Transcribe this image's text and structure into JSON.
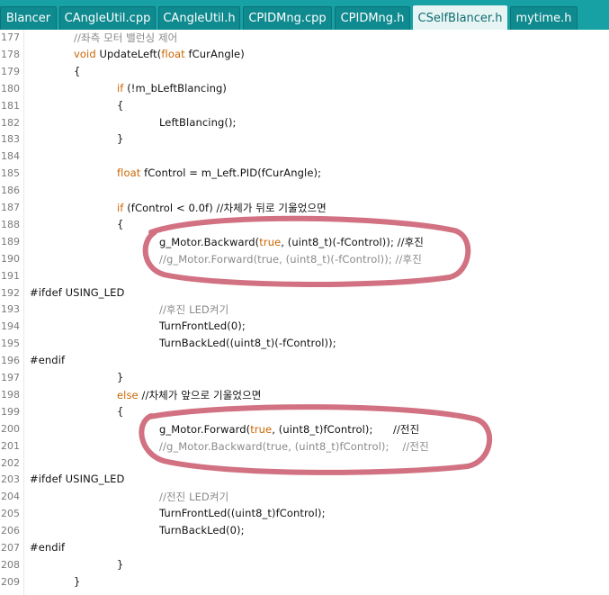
{
  "tabs": [
    {
      "label": "Blancer",
      "width": 63,
      "active": false
    },
    {
      "label": "CAngleUtil.cpp",
      "width": 107,
      "active": false
    },
    {
      "label": "CAngleUtil.h",
      "width": 91,
      "active": false
    },
    {
      "label": "CPIDMng.cpp",
      "width": 99,
      "active": false
    },
    {
      "label": "CPIDMng.h",
      "width": 84,
      "active": false
    },
    {
      "label": "CSelfBlancer.h",
      "width": 105,
      "active": true
    },
    {
      "label": "mytime.h",
      "width": 75,
      "active": false
    }
  ],
  "colors": {
    "tab_bar": "#17A1A5",
    "keyword": "#CC6600",
    "comment": "#8a8a8a",
    "annotation": "#C9586B"
  },
  "lines": [
    {
      "n": "177",
      "indent": 1,
      "segs": [
        [
          "//좌측 모터 밸런싱 제어",
          ""
        ]
      ],
      "cm": true
    },
    {
      "n": "178",
      "indent": 1,
      "segs": [
        [
          "void",
          "kw"
        ],
        [
          " UpdateLeft(",
          ""
        ],
        [
          "float",
          "kw"
        ],
        [
          " fCurAngle)",
          ""
        ]
      ]
    },
    {
      "n": "179",
      "indent": 1,
      "segs": [
        [
          "{",
          ""
        ]
      ]
    },
    {
      "n": "180",
      "indent": 2,
      "segs": [
        [
          "if",
          "kw"
        ],
        [
          " (!m_bLeftBlancing)",
          ""
        ]
      ]
    },
    {
      "n": "181",
      "indent": 2,
      "segs": [
        [
          "{",
          ""
        ]
      ]
    },
    {
      "n": "182",
      "indent": 3,
      "segs": [
        [
          "LeftBlancing();",
          ""
        ]
      ]
    },
    {
      "n": "183",
      "indent": 2,
      "segs": [
        [
          "}",
          ""
        ]
      ]
    },
    {
      "n": "184",
      "indent": 0,
      "segs": []
    },
    {
      "n": "185",
      "indent": 2,
      "segs": [
        [
          "float",
          "kw"
        ],
        [
          " fControl = m_Left.PID(fCurAngle);",
          ""
        ]
      ]
    },
    {
      "n": "186",
      "indent": 0,
      "segs": []
    },
    {
      "n": "187",
      "indent": 2,
      "segs": [
        [
          "if",
          "kw"
        ],
        [
          " (fControl < 0.0f) //차체가 뒤로 기울었으면",
          ""
        ]
      ]
    },
    {
      "n": "188",
      "indent": 2,
      "segs": [
        [
          "{",
          ""
        ]
      ]
    },
    {
      "n": "189",
      "indent": 3,
      "segs": [
        [
          "g_Motor.Backward(",
          ""
        ],
        [
          "true",
          "kw"
        ],
        [
          ", (uint8_t)(-fControl)); //후진",
          ""
        ]
      ]
    },
    {
      "n": "190",
      "indent": 3,
      "segs": [
        [
          "//g_Motor.Forward(true, (uint8_t)(-fControl)); //후진",
          ""
        ]
      ],
      "cm": true
    },
    {
      "n": "191",
      "indent": 0,
      "segs": []
    },
    {
      "n": "192",
      "indent": 0,
      "segs": [
        [
          "#ifdef USING_LED",
          ""
        ]
      ]
    },
    {
      "n": "193",
      "indent": 3,
      "segs": [
        [
          "//후진 LED켜기",
          ""
        ]
      ],
      "cm": true
    },
    {
      "n": "194",
      "indent": 3,
      "segs": [
        [
          "TurnFrontLed(0);",
          ""
        ]
      ]
    },
    {
      "n": "195",
      "indent": 3,
      "segs": [
        [
          "TurnBackLed((uint8_t)(-fControl));",
          ""
        ]
      ]
    },
    {
      "n": "196",
      "indent": 0,
      "segs": [
        [
          "#endif",
          ""
        ]
      ]
    },
    {
      "n": "197",
      "indent": 2,
      "segs": [
        [
          "}",
          ""
        ]
      ]
    },
    {
      "n": "198",
      "indent": 2,
      "segs": [
        [
          "else",
          "kw"
        ],
        [
          " //차체가 앞으로 기울었으면",
          ""
        ]
      ]
    },
    {
      "n": "199",
      "indent": 2,
      "segs": [
        [
          "{",
          ""
        ]
      ]
    },
    {
      "n": "200",
      "indent": 3,
      "segs": [
        [
          "g_Motor.Forward(",
          ""
        ],
        [
          "true",
          "kw"
        ],
        [
          ", (uint8_t)fControl);      //전진",
          ""
        ]
      ]
    },
    {
      "n": "201",
      "indent": 3,
      "segs": [
        [
          "//g_Motor.Backward(true, (uint8_t)fControl);    //전진",
          ""
        ]
      ],
      "cm": true
    },
    {
      "n": "202",
      "indent": 0,
      "segs": []
    },
    {
      "n": "203",
      "indent": 0,
      "segs": [
        [
          "#ifdef USING_LED",
          ""
        ]
      ]
    },
    {
      "n": "204",
      "indent": 3,
      "segs": [
        [
          "//전진 LED켜기",
          ""
        ]
      ],
      "cm": true
    },
    {
      "n": "205",
      "indent": 3,
      "segs": [
        [
          "TurnFrontLed((uint8_t)fControl);",
          ""
        ]
      ]
    },
    {
      "n": "206",
      "indent": 3,
      "segs": [
        [
          "TurnBackLed(0);",
          ""
        ]
      ]
    },
    {
      "n": "207",
      "indent": 0,
      "segs": [
        [
          "#endif",
          ""
        ]
      ]
    },
    {
      "n": "208",
      "indent": 2,
      "segs": [
        [
          "}",
          ""
        ]
      ]
    },
    {
      "n": "209",
      "indent": 1,
      "segs": [
        [
          "}",
          ""
        ]
      ]
    }
  ]
}
